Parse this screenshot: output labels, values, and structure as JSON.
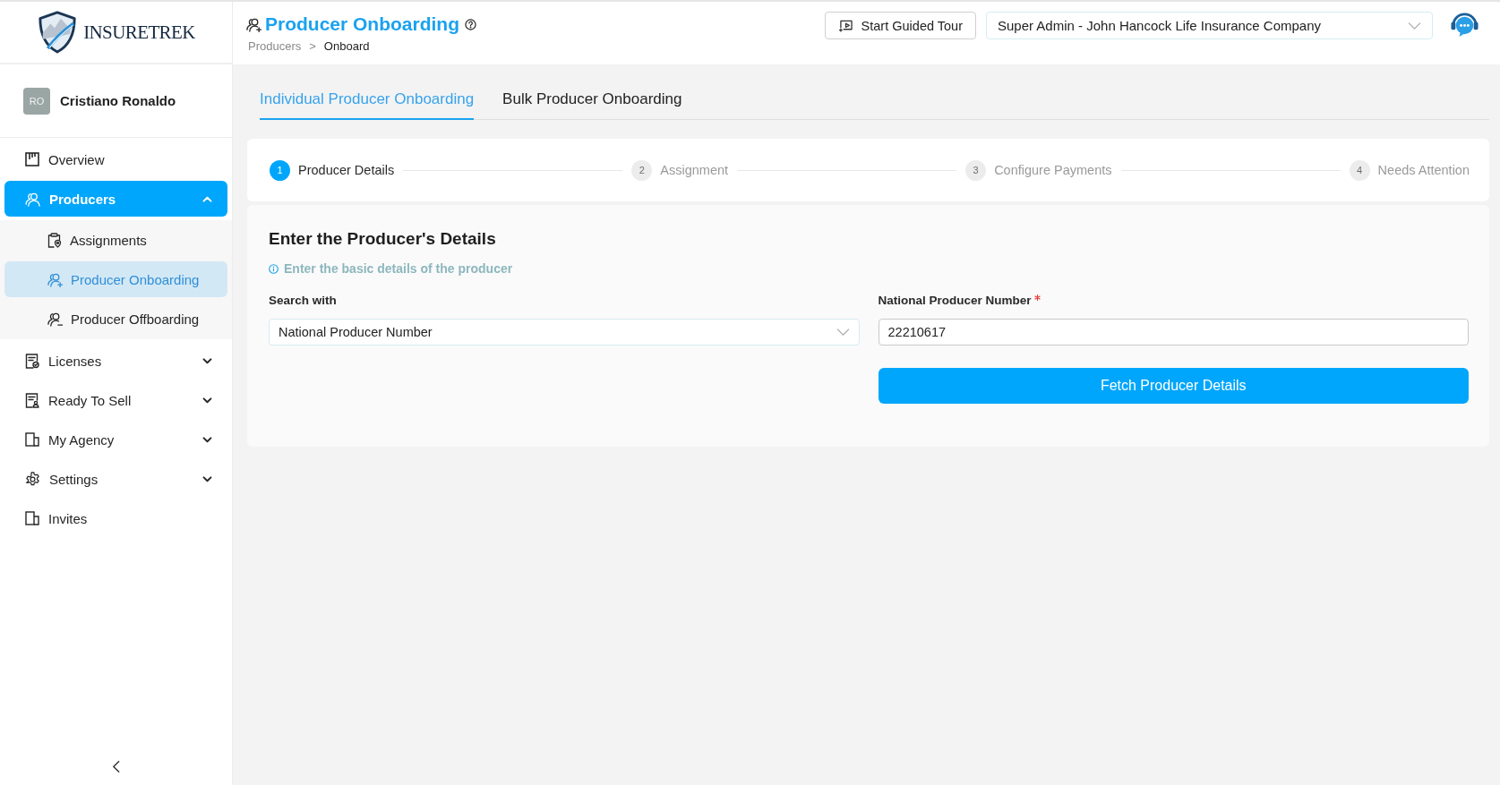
{
  "logo": {
    "text": "INSURETREK"
  },
  "user": {
    "initials": "RO",
    "name": "Cristiano Ronaldo"
  },
  "sidebar": {
    "items": [
      {
        "kind": "link",
        "label": "Overview",
        "selected": false
      },
      {
        "kind": "group",
        "label": "Producers",
        "selected": true,
        "expanded": true,
        "children": [
          {
            "label": "Assignments",
            "selected": false
          },
          {
            "label": "Producer Onboarding",
            "selected": true
          },
          {
            "label": "Producer Offboarding",
            "selected": false
          }
        ]
      },
      {
        "kind": "group",
        "label": "Licenses",
        "selected": false,
        "expanded": false
      },
      {
        "kind": "group",
        "label": "Ready To Sell",
        "selected": false,
        "expanded": false
      },
      {
        "kind": "group",
        "label": "My Agency",
        "selected": false,
        "expanded": false
      },
      {
        "kind": "group",
        "label": "Settings",
        "selected": false,
        "expanded": false
      },
      {
        "kind": "link",
        "label": "Invites",
        "selected": false
      }
    ]
  },
  "header": {
    "title": "Producer Onboarding",
    "breadcrumb": {
      "items": [
        "Producers",
        "Onboard"
      ],
      "separator": ">"
    },
    "guided_tour_button": "Start Guided Tour",
    "account_selector": {
      "value": "Super Admin - John Hancock Life Insurance Company"
    }
  },
  "tabs": [
    {
      "label": "Individual Producer Onboarding",
      "selected": true
    },
    {
      "label": "Bulk Producer Onboarding",
      "selected": false
    }
  ],
  "stepper": {
    "steps": [
      {
        "number": "1",
        "label": "Producer Details",
        "selected": true
      },
      {
        "number": "2",
        "label": "Assignment",
        "selected": false
      },
      {
        "number": "3",
        "label": "Configure Payments",
        "selected": false
      },
      {
        "number": "4",
        "label": "Needs Attention",
        "selected": false
      }
    ]
  },
  "form": {
    "title": "Enter the Producer's Details",
    "hint": "Enter the basic details of the producer",
    "fields": [
      {
        "kind": "select",
        "label": "Search with",
        "value": "National Producer Number"
      },
      {
        "kind": "input",
        "label": "National Producer Number",
        "value": "22210617",
        "required": true
      }
    ],
    "button": "Fetch Producer Details"
  }
}
